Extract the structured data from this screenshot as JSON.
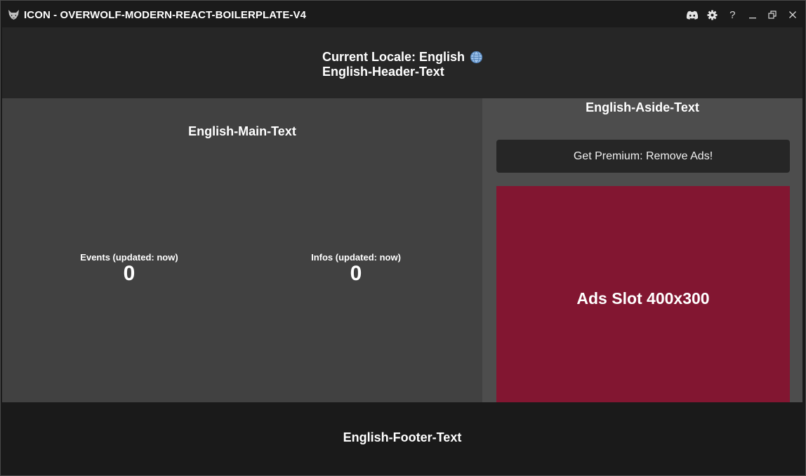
{
  "titlebar": {
    "title": "ICON - OVERWOLF-MODERN-REACT-BOILERPLATE-V4",
    "controls": {
      "help": "?"
    }
  },
  "header": {
    "locale": "Current Locale: English",
    "text": "English-Header-Text"
  },
  "main": {
    "title": "English-Main-Text",
    "stats": [
      {
        "label": "Events (updated: now)",
        "value": "0"
      },
      {
        "label": "Infos (updated: now)",
        "value": "0"
      }
    ]
  },
  "aside": {
    "title": "English-Aside-Text",
    "premium_label": "Get Premium: Remove Ads!",
    "ad_label": "Ads Slot 400x300"
  },
  "footer": {
    "text": "English-Footer-Text"
  },
  "colors": {
    "ad_slot": "#821631",
    "header": "#262626",
    "main": "#414141",
    "aside": "#4d4d4d",
    "footer": "#1a1a1a"
  },
  "icons": [
    "wolf-icon",
    "discord-icon",
    "gear-icon",
    "help-icon",
    "minimize-icon",
    "restore-icon",
    "close-icon",
    "globe-icon"
  ]
}
